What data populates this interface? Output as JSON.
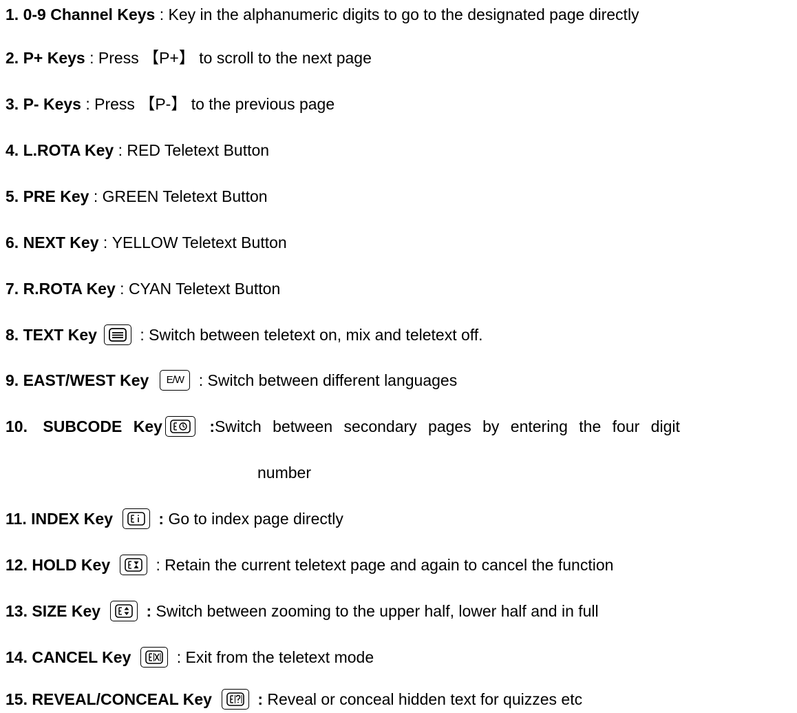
{
  "items": [
    {
      "num": "1.",
      "name": "0-9 Channel Keys",
      "sep": " : ",
      "desc": "Key in the alphanumeric digits to go to the designated page directly"
    },
    {
      "num": "2.",
      "name": "P+ Keys",
      "sep": " : ",
      "desc_pre": "Press ",
      "bracket_open": "【",
      "bracket_key": "P+",
      "bracket_close": "】",
      "desc_post": " to scroll to the next page"
    },
    {
      "num": "3.",
      "name": "P- Keys",
      "sep": " : ",
      "desc_pre": "Press ",
      "bracket_open": "【",
      "bracket_key": "P-",
      "bracket_close": "】",
      "desc_post": " to the previous page"
    },
    {
      "num": "4.",
      "name": "L.ROTA Key",
      "sep": " : ",
      "desc": "RED Teletext Button"
    },
    {
      "num": "5.",
      "name": "PRE Key",
      "sep": " : ",
      "desc": "GREEN Teletext Button"
    },
    {
      "num": "6.",
      "name": "NEXT Key",
      "sep": " : ",
      "desc": "YELLOW Teletext Button"
    },
    {
      "num": "7.",
      "name": "R.ROTA Key",
      "sep": " : ",
      "desc": "CYAN Teletext Button"
    },
    {
      "num": "8.",
      "name": "TEXT Key",
      "icon": "text-icon",
      "sep": " : ",
      "desc": "Switch between teletext on, mix and teletext off."
    },
    {
      "num": "9.",
      "name": "EAST/WEST Key",
      "icon": "east-west-icon",
      "icon_label": "E/W",
      "sep": " : ",
      "desc": "Switch between different languages"
    },
    {
      "num": "10.",
      "name": "SUBCODE Key",
      "icon": "subcode-icon",
      "sep": " :",
      "desc": "Switch between secondary pages by entering the four digit",
      "desc_cont": "number"
    },
    {
      "num": "11.",
      "name": "INDEX Key",
      "icon": "index-icon",
      "sep": " : ",
      "desc": "Go to index page directly"
    },
    {
      "num": "12.",
      "name": "HOLD Key",
      "icon": "hold-icon",
      "sep": " : ",
      "desc": "Retain the current teletext page and again to cancel the function"
    },
    {
      "num": "13.",
      "name": "SIZE Key",
      "icon": "size-icon",
      "sep": " : ",
      "desc": "Switch between zooming to the upper half, lower half and in full"
    },
    {
      "num": "14.",
      "name": "CANCEL Key",
      "icon": "cancel-icon",
      "sep": " : ",
      "desc": "Exit from the teletext mode"
    },
    {
      "num": "15.",
      "name": "REVEAL/CONCEAL Key",
      "icon": "reveal-icon",
      "sep": " : ",
      "desc": "Reveal or conceal hidden text for quizzes etc"
    }
  ]
}
